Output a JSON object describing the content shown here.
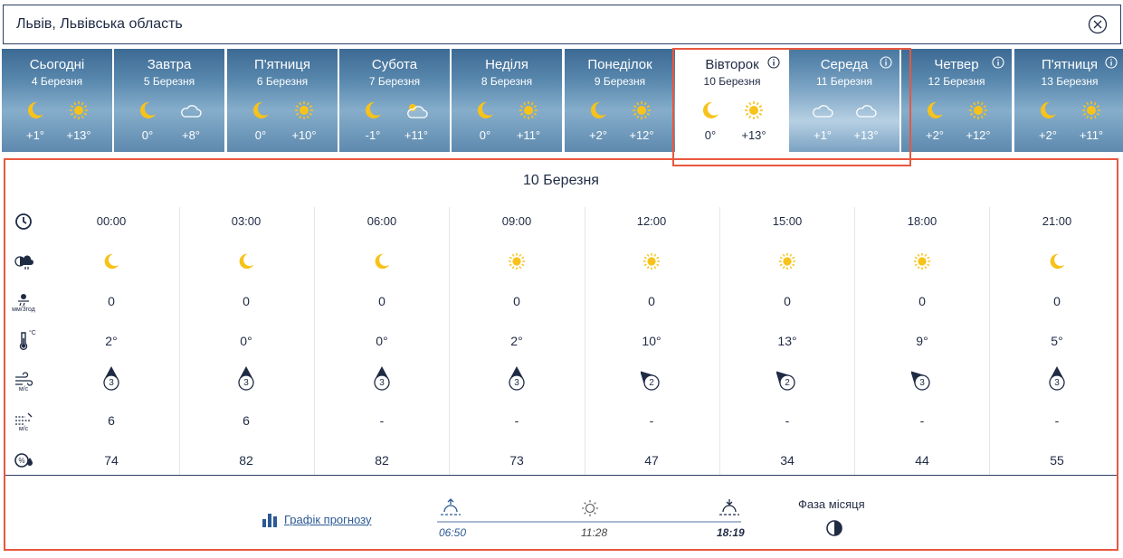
{
  "search": {
    "location": "Львів, Львівська область"
  },
  "days": [
    {
      "name": "Сьогодні",
      "date": "4 Березня",
      "icon1": "moon-icon",
      "icon2": "sun-icon",
      "min": "+1°",
      "max": "+13°",
      "info": false
    },
    {
      "name": "Завтра",
      "date": "5 Березня",
      "icon1": "moon-icon",
      "icon2": "cloud-icon",
      "min": "0°",
      "max": "+8°",
      "info": false
    },
    {
      "name": "П'ятниця",
      "date": "6 Березня",
      "icon1": "moon-icon",
      "icon2": "sun-icon",
      "min": "0°",
      "max": "+10°",
      "info": false
    },
    {
      "name": "Субота",
      "date": "7 Березня",
      "icon1": "moon-icon",
      "icon2": "partly-cloudy-icon",
      "min": "-1°",
      "max": "+11°",
      "info": false
    },
    {
      "name": "Неділя",
      "date": "8 Березня",
      "icon1": "moon-icon",
      "icon2": "sun-icon",
      "min": "0°",
      "max": "+11°",
      "info": false
    },
    {
      "name": "Понеділок",
      "date": "9 Березня",
      "icon1": "moon-icon",
      "icon2": "sun-icon",
      "min": "+2°",
      "max": "+12°",
      "info": false
    },
    {
      "name": "Вівторок",
      "date": "10 Березня",
      "icon1": "moon-icon",
      "icon2": "sun-icon",
      "min": "0°",
      "max": "+13°",
      "info": true
    },
    {
      "name": "Середа",
      "date": "11 Березня",
      "icon1": "cloud-icon",
      "icon2": "cloud-icon",
      "min": "+1°",
      "max": "+13°",
      "info": true
    },
    {
      "name": "Четвер",
      "date": "12 Березня",
      "icon1": "moon-icon",
      "icon2": "sun-icon",
      "min": "+2°",
      "max": "+12°",
      "info": true
    },
    {
      "name": "П'ятниця",
      "date": "13 Березня",
      "icon1": "moon-icon",
      "icon2": "sun-icon",
      "min": "+2°",
      "max": "+11°",
      "info": true
    }
  ],
  "selected_day": "Вівторок",
  "detail": {
    "title": "10 Березня",
    "row_icons": [
      "clock-icon",
      "sky-icon",
      "precipitation-icon",
      "thermometer-icon",
      "wind-icon",
      "gust-icon",
      "humidity-icon"
    ],
    "precip_unit": "мм/3год",
    "thermo_unit": "°C",
    "wind_unit": "м/с",
    "gust_unit": "м/с",
    "hours": [
      {
        "time": "00:00",
        "sky": "moon-icon",
        "precip": "0",
        "temp": "2°",
        "wind": "3",
        "wind_dir": "north",
        "gust": "6",
        "humidity": "74"
      },
      {
        "time": "03:00",
        "sky": "moon-icon",
        "precip": "0",
        "temp": "0°",
        "wind": "3",
        "wind_dir": "north",
        "gust": "6",
        "humidity": "82"
      },
      {
        "time": "06:00",
        "sky": "moon-icon",
        "precip": "0",
        "temp": "0°",
        "wind": "3",
        "wind_dir": "north",
        "gust": "-",
        "humidity": "82"
      },
      {
        "time": "09:00",
        "sky": "sun-icon",
        "precip": "0",
        "temp": "2°",
        "wind": "3",
        "wind_dir": "north",
        "gust": "-",
        "humidity": "73"
      },
      {
        "time": "12:00",
        "sky": "sun-icon",
        "precip": "0",
        "temp": "10°",
        "wind": "2",
        "wind_dir": "north-west",
        "gust": "-",
        "humidity": "47"
      },
      {
        "time": "15:00",
        "sky": "sun-icon",
        "precip": "0",
        "temp": "13°",
        "wind": "2",
        "wind_dir": "north-west",
        "gust": "-",
        "humidity": "34"
      },
      {
        "time": "18:00",
        "sky": "sun-icon",
        "precip": "0",
        "temp": "9°",
        "wind": "3",
        "wind_dir": "north-west",
        "gust": "-",
        "humidity": "44"
      },
      {
        "time": "21:00",
        "sky": "moon-icon",
        "precip": "0",
        "temp": "5°",
        "wind": "3",
        "wind_dir": "north",
        "gust": "-",
        "humidity": "55"
      }
    ]
  },
  "bottom": {
    "chart_link": "Графік прогнозу",
    "sunrise": "06:50",
    "noon": "11:28",
    "sunset": "18:19",
    "moon_phase_label": "Фаза місяця"
  },
  "colors": {
    "accent": "#e8583f",
    "sun": "#f7c21a",
    "text": "#1f2a44",
    "link": "#2b5a95"
  }
}
